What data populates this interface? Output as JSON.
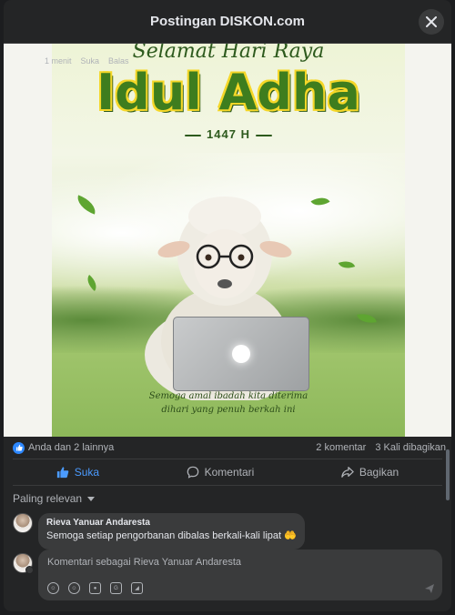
{
  "modal": {
    "title": "Postingan DISKON.com"
  },
  "poster": {
    "greeting": "Selamat Hari Raya",
    "headline": "Idul Adha",
    "year": "1447 H",
    "caption_line1": "Semoga amal ibadah kita diterima",
    "caption_line2": "dihari yang penuh berkah ini"
  },
  "stats": {
    "reactions": "Anda dan 2 lainnya",
    "comments": "2 komentar",
    "shares": "3 Kali dibagikan"
  },
  "actions": {
    "like": "Suka",
    "comment": "Komentari",
    "share": "Bagikan"
  },
  "sort": {
    "label": "Paling relevan"
  },
  "comments": [
    {
      "author": "Rieva Yanuar Andaresta",
      "text": "Semoga setiap pengorbanan dibalas berkali-kali lipat 🤲",
      "time": "1 menit",
      "like": "Suka",
      "reply": "Balas"
    }
  ],
  "composer": {
    "placeholder": "Komentari sebagai Rieva Yanuar Andaresta",
    "tools": [
      "avatar-sticker-icon",
      "emoji-icon",
      "camera-icon",
      "gif-icon",
      "sticker-icon"
    ]
  },
  "colors": {
    "background": "#242526",
    "accent": "#2d88ff",
    "bubble": "#3a3b3c",
    "poster_green": "#3e7d1e"
  }
}
